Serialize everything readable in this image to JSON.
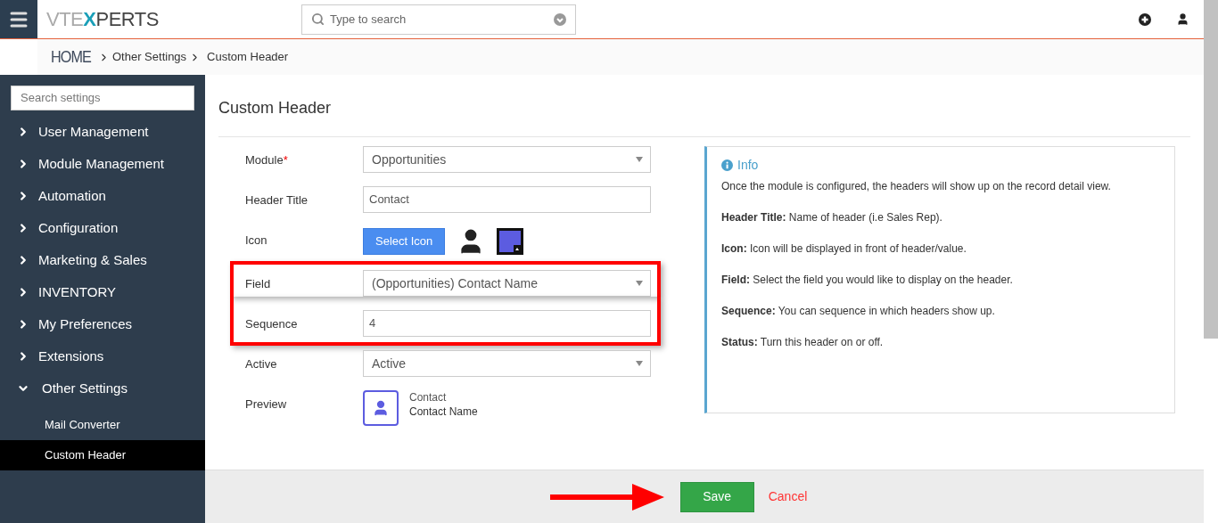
{
  "logo": {
    "before": "VTE",
    "accent": "X",
    "after": "PERTS"
  },
  "search": {
    "placeholder": "Type to search"
  },
  "breadcrumb": [
    {
      "label": "HOME",
      "kind": "home"
    },
    {
      "label": "Other Settings",
      "kind": "link"
    },
    {
      "label": "Custom Header",
      "kind": "current"
    }
  ],
  "sidebar": {
    "search_placeholder": "Search settings",
    "items": [
      {
        "label": "User Management",
        "expanded": false
      },
      {
        "label": "Module Management",
        "expanded": false
      },
      {
        "label": "Automation",
        "expanded": false
      },
      {
        "label": "Configuration",
        "expanded": false
      },
      {
        "label": "Marketing & Sales",
        "expanded": false
      },
      {
        "label": "INVENTORY",
        "expanded": false
      },
      {
        "label": "My Preferences",
        "expanded": false
      },
      {
        "label": "Extensions",
        "expanded": false
      },
      {
        "label": "Other Settings",
        "expanded": true,
        "children": [
          {
            "label": "Mail Converter",
            "selected": false
          },
          {
            "label": "Custom Header",
            "selected": true
          }
        ]
      }
    ]
  },
  "page_title": "Custom Header",
  "form": [
    {
      "kind": "select",
      "label": "Module",
      "required_mark": "*",
      "value": "Opportunities",
      "highlighted": false
    },
    {
      "kind": "text",
      "label": "Header Title",
      "value": "Contact",
      "highlighted": false
    },
    {
      "kind": "icon",
      "label": "Icon",
      "button": "Select Icon",
      "color": "#5c5ce0",
      "highlighted": false
    },
    {
      "kind": "select",
      "label": "Field",
      "value": "(Opportunities) Contact Name",
      "highlighted": true
    },
    {
      "kind": "text",
      "label": "Sequence",
      "value": "4",
      "highlighted": true
    },
    {
      "kind": "select",
      "label": "Active",
      "value": "Active",
      "highlighted": false
    },
    {
      "kind": "preview",
      "label": "Preview",
      "title": "Contact",
      "value": "Contact Name",
      "highlighted": false
    }
  ],
  "info": {
    "title": "Info",
    "paragraphs": [
      "Once the module is configured, the headers will show up on the record detail view.",
      "**Header Title:** Name of header (i.e Sales Rep).",
      "**Icon:** Icon will be displayed in front of header/value.",
      "**Field:** Select the field you would like to display on the header.",
      "**Sequence:** You can sequence in which headers show up.",
      "**Status:** Turn this header on or off."
    ]
  },
  "footer": {
    "save": "Save",
    "cancel": "Cancel"
  }
}
